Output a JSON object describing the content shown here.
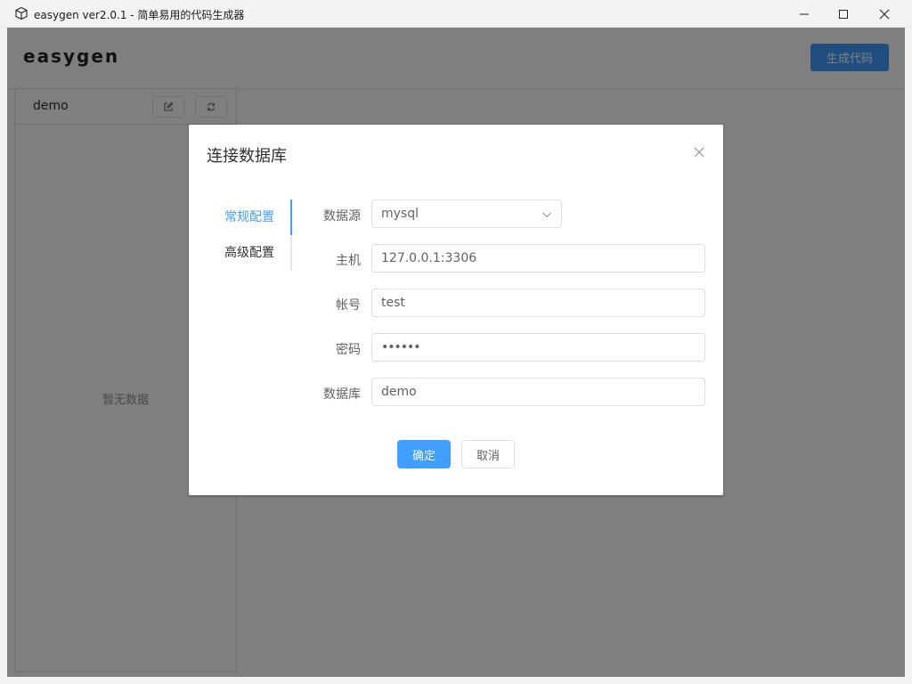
{
  "window": {
    "title": "easygen ver2.0.1 - 简单易用的代码生成器",
    "icons": [
      "cube-icon",
      "minimize-icon",
      "maximize-icon",
      "close-icon"
    ]
  },
  "app": {
    "brand": "easygen",
    "generate_label": "生成代码"
  },
  "sidebar": {
    "connection_name": "demo",
    "edit_icon": "edit-icon",
    "refresh_icon": "refresh-icon",
    "empty_text": "暂无数据"
  },
  "dialog": {
    "title": "连接数据库",
    "tabs": [
      {
        "label": "常规配置",
        "active": true
      },
      {
        "label": "高级配置",
        "active": false
      }
    ],
    "form": {
      "datasource_label": "数据源",
      "datasource_value": "mysql",
      "host_label": "主机",
      "host_value": "127.0.0.1:3306",
      "account_label": "帐号",
      "account_value": "test",
      "password_label": "密码",
      "password_value": "••••••",
      "database_label": "数据库",
      "database_value": "demo"
    },
    "confirm_label": "确定",
    "cancel_label": "取消"
  },
  "colors": {
    "accent": "#409eff",
    "overlay": "rgba(0,0,0,0.5)",
    "border": "#dcdfe6"
  }
}
